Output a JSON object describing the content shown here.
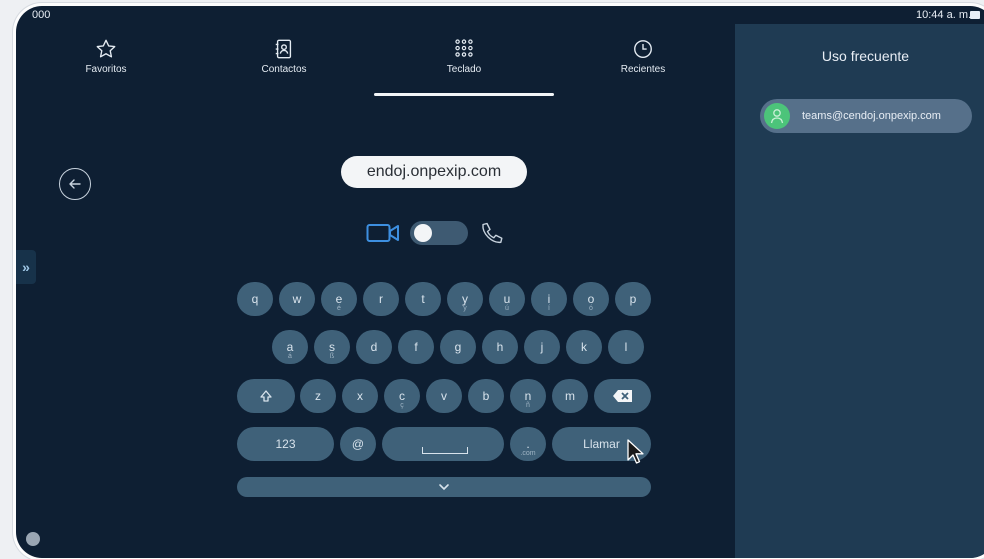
{
  "status": {
    "left_fragment": "000",
    "time": "10:44 a. m."
  },
  "nav": {
    "tabs": [
      {
        "label": "Favoritos",
        "icon": "star-icon"
      },
      {
        "label": "Contactos",
        "icon": "contacts-book-icon"
      },
      {
        "label": "Teclado",
        "icon": "dialpad-icon",
        "active": true
      },
      {
        "label": "Recientes",
        "icon": "clock-icon"
      }
    ]
  },
  "dial": {
    "address": "endoj.onpexip.com",
    "mode": "video"
  },
  "keyboard": {
    "row1": [
      {
        "k": "q",
        "s": ""
      },
      {
        "k": "w",
        "s": ""
      },
      {
        "k": "e",
        "s": "é"
      },
      {
        "k": "r",
        "s": ""
      },
      {
        "k": "t",
        "s": ""
      },
      {
        "k": "y",
        "s": "ý"
      },
      {
        "k": "u",
        "s": "ú"
      },
      {
        "k": "i",
        "s": "í"
      },
      {
        "k": "o",
        "s": "ó"
      },
      {
        "k": "p",
        "s": ""
      }
    ],
    "row2": [
      {
        "k": "a",
        "s": "á"
      },
      {
        "k": "s",
        "s": "ß"
      },
      {
        "k": "d",
        "s": ""
      },
      {
        "k": "f",
        "s": ""
      },
      {
        "k": "g",
        "s": ""
      },
      {
        "k": "h",
        "s": ""
      },
      {
        "k": "j",
        "s": ""
      },
      {
        "k": "k",
        "s": ""
      },
      {
        "k": "l",
        "s": ""
      }
    ],
    "row3": [
      {
        "k": "z",
        "s": ""
      },
      {
        "k": "x",
        "s": ""
      },
      {
        "k": "c",
        "s": "ç"
      },
      {
        "k": "v",
        "s": ""
      },
      {
        "k": "b",
        "s": ""
      },
      {
        "k": "n",
        "s": "ñ"
      },
      {
        "k": "m",
        "s": ""
      }
    ],
    "numbers_label": "123",
    "at_label": "@",
    "dot_label": ".",
    "dot_sub": ".com",
    "call_label": "Llamar"
  },
  "recent": {
    "title": "Uso frecuente",
    "items": [
      {
        "address": "teams@cendoj.onpexip.com"
      }
    ]
  },
  "colors": {
    "background": "#0e1f33",
    "key": "#3f6179",
    "panel": "#1f3b53",
    "accent": "#4cc47a",
    "video_icon": "#3d8fe0"
  }
}
